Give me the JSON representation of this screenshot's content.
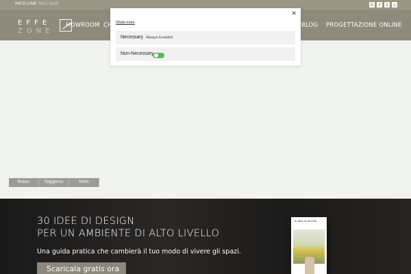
{
  "infobar": {
    "label": "INFO-LINE",
    "phone": "0942 5435",
    "social_icons": [
      "houzz-icon",
      "facebook-icon",
      "twitter-icon",
      "instagram-icon"
    ]
  },
  "header": {
    "logo_line1": "EFFE",
    "logo_line2": "ZONE",
    "nav": [
      {
        "label": "HOWROOM"
      },
      {
        "label": "CH"
      },
      {
        "label": "BLOG"
      },
      {
        "label": "PROGETTAZIONE ONLINE"
      }
    ]
  },
  "cookie_modal": {
    "close": "×",
    "show_more": "Show more",
    "categories": [
      {
        "title": "Necessary",
        "badge": "Always Enabled"
      },
      {
        "title": "Non-Necessary",
        "toggle_on": true
      }
    ]
  },
  "chips": [
    "Bonus",
    "Soggiorno",
    "Notte"
  ],
  "banner": {
    "title_line1": "30 IDEE DI DESIGN",
    "title_line2": "PER UN AMBIENTE DI ALTO LIVELLO",
    "text": "Una guida pratica che cambierà il tuo modo di vivere gli spazi.",
    "button": "Scaricala gratis ora",
    "book_title": "30 IDEE DI DESIGN"
  },
  "colors": {
    "header_bg": "#8f8a7c",
    "page_bg": "#f1f4ee",
    "toggle_on": "#5cb85c",
    "banner_bg": "#1a1919"
  }
}
